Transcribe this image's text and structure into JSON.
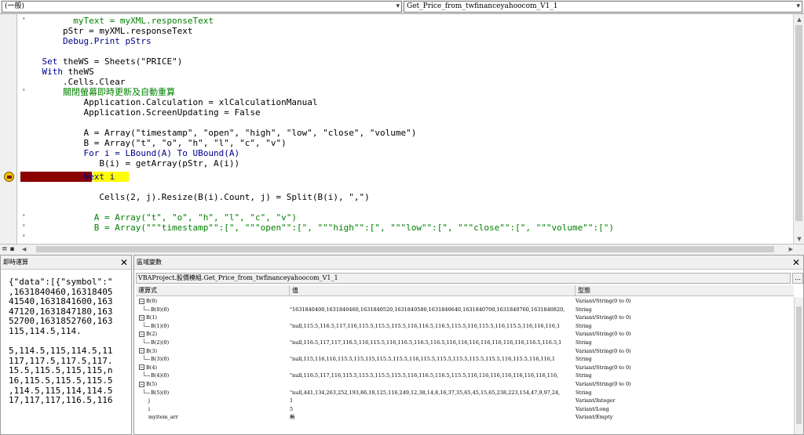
{
  "procedure_combos": {
    "object": "(一般)",
    "procedure": "Get_Price_from_twfinanceyahoocom_V1_1"
  },
  "code_lines": [
    "'         myText = myXML.responseText",
    "        pStr = myXML.responseText",
    "        Debug.Print pStrs",
    "",
    "    Set theWS = Sheets(\"PRICE\")",
    "    With theWS",
    "        .Cells.Clear",
    "'       關閉螢幕即時更新及自動重算",
    "            Application.Calculation = xlCalculationManual",
    "            Application.ScreenUpdating = False",
    "",
    "            A = Array(\"timestamp\", \"open\", \"high\", \"low\", \"close\", \"volume\")",
    "            B = Array(\"t\", \"o\", \"h\", \"l\", \"c\", \"v\")",
    "            For i = LBound(A) To UBound(A)",
    "               B(i) = getArray(pStr, A(i))",
    "            Next i",
    "",
    "               Cells(2, j).Resize(B(i).Count, j) = Split(B(i), \",\")",
    "",
    "'             A = Array(\"t\", \"o\", \"h\", \"l\", \"c\", \"v\")",
    "'             B = Array(\"\"\"timestamp\"\":[\", \"\"\"open\"\":[\", \"\"\"high\"\":[\", \"\"\"low\"\":[\", \"\"\"close\"\":[\", \"\"\"volume\"\":[\")",
    "'"
  ],
  "immediate": {
    "title": "即時運算",
    "text": "{\"data\":[{\"symbol\":\"\n,1631840460,16318405\n41540,1631841600,163\n47120,1631847180,163\n52700,1631852760,163\n115,114.5,114.\n\n5,114.5,115,114.5,11\n117,117.5,117.5,117.\n15.5,115.5,115,115,n\n16,115.5,115.5,115.5\n,114.5,115,114,114.5\n17,117,117,116.5,116"
  },
  "locals": {
    "title": "區域變數",
    "path": "VBAProject.股價模組.Get_Price_from_twfinanceyahoocom_V1_1",
    "columns": {
      "expression": "運算式",
      "value": "值",
      "type": "型態"
    },
    "rows": [
      {
        "expr": "B(0)",
        "value": "",
        "type": "Variant/String(0 to 0)",
        "level": 0,
        "expander": "−"
      },
      {
        "expr": "B(0)(0)",
        "value": "\"1631840400,1631840460,1631840520,1631840580,1631840640,1631840700,1631840760,1631840820,",
        "type": "String",
        "level": 1,
        "expander": ""
      },
      {
        "expr": "B(1)",
        "value": "",
        "type": "Variant/String(0 to 0)",
        "level": 0,
        "expander": "−"
      },
      {
        "expr": "B(1)(0)",
        "value": "\"null,115.5,116.5,117,116,115.5,115.5,115.5,116,116.5,116.5,115.5,116,115.5,116,115.5,116,116,116,1",
        "type": "String",
        "level": 1,
        "expander": ""
      },
      {
        "expr": "B(2)",
        "value": "",
        "type": "Variant/String(0 to 0)",
        "level": 0,
        "expander": "−"
      },
      {
        "expr": "B(2)(0)",
        "value": "\"null,116.5,117,117,116.5,116,115.5,116,116.5,116.5,116.5,116,116,116,116,116,116,116,116.5,116.5,1",
        "type": "String",
        "level": 1,
        "expander": ""
      },
      {
        "expr": "B(3)",
        "value": "",
        "type": "Variant/String(0 to 0)",
        "level": 0,
        "expander": "−"
      },
      {
        "expr": "B(3)(0)",
        "value": "\"null,115,116,116,115.5,115,115,115.5,115.5,116,115.5,115.5,115.5,115.5,115.5,116,115.5,116,116,1",
        "type": "String",
        "level": 1,
        "expander": ""
      },
      {
        "expr": "B(4)",
        "value": "",
        "type": "Variant/String(0 to 0)",
        "level": 0,
        "expander": "−"
      },
      {
        "expr": "B(4)(0)",
        "value": "\"null,116.5,117,116,115.5,115.5,115.5,115.5,116,116.5,116.5,115.5,116,116,116,116,116,116,116,116,",
        "type": "String",
        "level": 1,
        "expander": ""
      },
      {
        "expr": "B(5)",
        "value": "",
        "type": "Variant/String(0 to 0)",
        "level": 0,
        "expander": "−"
      },
      {
        "expr": "B(5)(0)",
        "value": "\"null,441,134,263,252,193,86,18,125,116,249,12,38,14,8,16,37,35,65,45,15,65,238,223,154,47,9,97,24,",
        "type": "String",
        "level": 1,
        "expander": ""
      },
      {
        "expr": "j",
        "value": "1",
        "type": "Variant/Integer",
        "level": 2,
        "expander": ""
      },
      {
        "expr": "i",
        "value": "5",
        "type": "Variant/Long",
        "level": 2,
        "expander": ""
      },
      {
        "expr": "myitem_arr",
        "value": "無",
        "type": "Variant/Empty",
        "level": 2,
        "expander": ""
      }
    ]
  },
  "icons": {
    "dropdown": "chevron-down-icon",
    "close": "close-icon",
    "breakpoint": "execution-pointer-icon"
  },
  "colors": {
    "keyword": "#00008b",
    "comment": "#008000",
    "execution_bar": "#8b0000",
    "execution_highlight": "#ffff00"
  }
}
